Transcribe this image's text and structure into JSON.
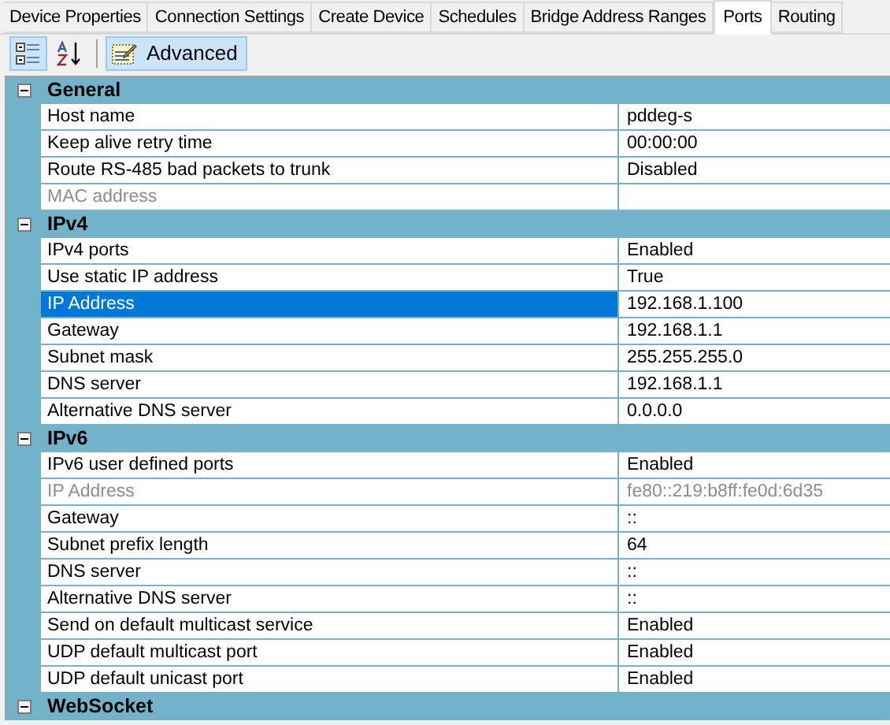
{
  "tabs": [
    {
      "label": "Device Properties",
      "selected": false
    },
    {
      "label": "Connection Settings",
      "selected": false
    },
    {
      "label": "Create Device",
      "selected": false
    },
    {
      "label": "Schedules",
      "selected": false
    },
    {
      "label": "Bridge Address Ranges",
      "selected": false
    },
    {
      "label": "Ports",
      "selected": true
    },
    {
      "label": "Routing",
      "selected": false
    }
  ],
  "toolbar": {
    "categorized_selected": true,
    "alphabetical_selected": false,
    "advanced": {
      "label": "Advanced",
      "selected": true
    }
  },
  "categories": [
    {
      "name": "General",
      "expanded": true,
      "properties": [
        {
          "name": "Host name",
          "value": "pddeg-s",
          "disabled": false,
          "selected": false
        },
        {
          "name": "Keep alive retry time",
          "value": "00:00:00",
          "disabled": false,
          "selected": false
        },
        {
          "name": "Route RS-485 bad packets to trunk",
          "value": "Disabled",
          "disabled": false,
          "selected": false
        },
        {
          "name": "MAC address",
          "disabled": true,
          "selected": false
        }
      ]
    },
    {
      "name": "IPv4",
      "expanded": true,
      "properties": [
        {
          "name": "IPv4 ports",
          "value": "Enabled",
          "disabled": false,
          "selected": false
        },
        {
          "name": "Use static IP address",
          "value": "True",
          "disabled": false,
          "selected": false
        },
        {
          "name": "IP Address",
          "value": "192.168.1.100",
          "disabled": false,
          "selected": true
        },
        {
          "name": "Gateway",
          "value": "192.168.1.1",
          "disabled": false,
          "selected": false
        },
        {
          "name": "Subnet mask",
          "value": "255.255.255.0",
          "disabled": false,
          "selected": false
        },
        {
          "name": "DNS server",
          "value": "192.168.1.1",
          "disabled": false,
          "selected": false
        },
        {
          "name": "Alternative DNS server",
          "value": "0.0.0.0",
          "disabled": false,
          "selected": false
        }
      ]
    },
    {
      "name": "IPv6",
      "expanded": true,
      "properties": [
        {
          "name": "IPv6 user defined ports",
          "value": "Enabled",
          "disabled": false,
          "selected": false
        },
        {
          "name": "IP Address",
          "value": "fe80::219:b8ff:fe0d:6d35",
          "disabled": true,
          "selected": false
        },
        {
          "name": "Gateway",
          "value": "::",
          "disabled": false,
          "selected": false
        },
        {
          "name": "Subnet prefix length",
          "value": "64",
          "disabled": false,
          "selected": false
        },
        {
          "name": "DNS server",
          "value": "::",
          "disabled": false,
          "selected": false
        },
        {
          "name": "Alternative DNS server",
          "value": "::",
          "disabled": false,
          "selected": false
        },
        {
          "name": "Send on default multicast service",
          "value": "Enabled",
          "disabled": false,
          "selected": false
        },
        {
          "name": "UDP default multicast port",
          "value": "Enabled",
          "disabled": false,
          "selected": false
        },
        {
          "name": "UDP default unicast port",
          "value": "Enabled",
          "disabled": false,
          "selected": false
        }
      ]
    },
    {
      "name": "WebSocket",
      "expanded": true
    }
  ]
}
